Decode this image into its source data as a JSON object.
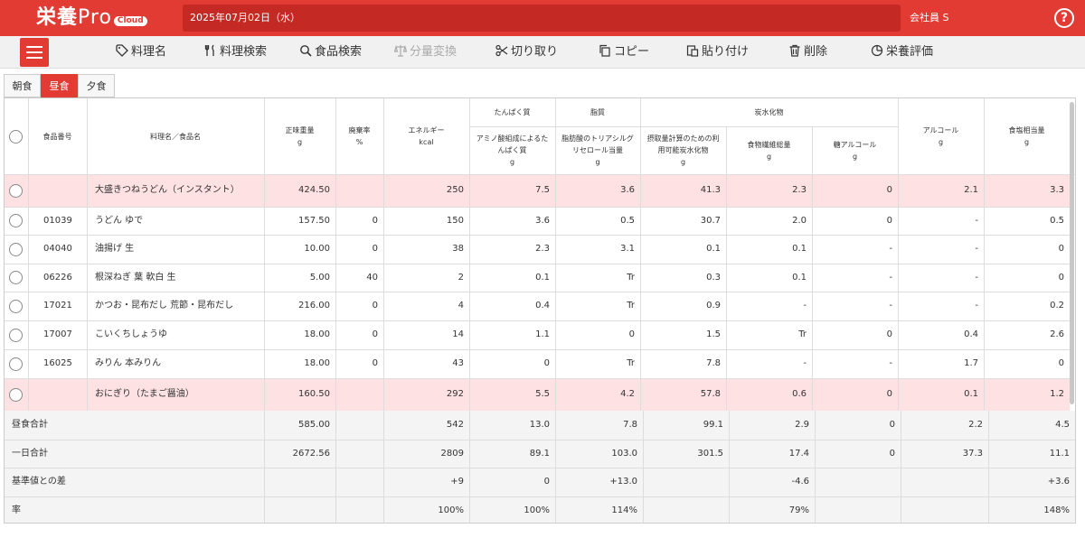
{
  "header": {
    "logo_main": "栄養",
    "logo_pro": "Pro",
    "logo_cloud": "Cloud",
    "date": "2025年07月02日（水）",
    "user": "会社員 S",
    "help_label": "?"
  },
  "toolbar": [
    {
      "label": "料理名",
      "icon": "tag-icon",
      "enabled": true
    },
    {
      "label": "料理検索",
      "icon": "utensils-icon",
      "enabled": true
    },
    {
      "label": "食品検索",
      "icon": "search-icon",
      "enabled": true
    },
    {
      "label": "分量変換",
      "icon": "scale-icon",
      "enabled": false
    },
    {
      "label": "切り取り",
      "icon": "scissors-icon",
      "enabled": true
    },
    {
      "label": "コピー",
      "icon": "copy-icon",
      "enabled": true
    },
    {
      "label": "貼り付け",
      "icon": "paste-icon",
      "enabled": true
    },
    {
      "label": "削除",
      "icon": "trash-icon",
      "enabled": true
    },
    {
      "label": "栄養評価",
      "icon": "pie-chart-icon",
      "enabled": true
    }
  ],
  "tabs": [
    {
      "label": "朝食",
      "active": false
    },
    {
      "label": "昼食",
      "active": true
    },
    {
      "label": "夕食",
      "active": false
    }
  ],
  "columns": {
    "code": "食品番号",
    "name": "料理名／食品名",
    "weight": [
      "正味重量",
      "g"
    ],
    "waste": [
      "廃棄率",
      "%"
    ],
    "energy": [
      "エネルギー",
      "kcal"
    ],
    "protein_group": "たんぱく質",
    "protein": [
      "アミノ酸組成によるた",
      "んぱく質",
      "g"
    ],
    "fat_group": "脂質",
    "fat": [
      "脂肪酸のトリアシルグ",
      "リセロール当量",
      "g"
    ],
    "carb_group": "炭水化物",
    "carb": [
      "摂取量計算のための利",
      "用可能炭水化物",
      "g"
    ],
    "fiber": [
      "食物繊維総量",
      "g"
    ],
    "sugar_alcohol": [
      "糖アルコール",
      "g"
    ],
    "alcohol": [
      "アルコール",
      "g"
    ],
    "salt": [
      "食塩相当量",
      "g"
    ]
  },
  "rows": [
    {
      "dish": true,
      "code": "",
      "name": "大盛きつねうどん（インスタント）",
      "weight": "424.50",
      "waste": "",
      "energy": "250",
      "protein": "7.5",
      "fat": "3.6",
      "carb": "41.3",
      "fiber": "2.3",
      "sugar_alcohol": "0",
      "alcohol": "2.1",
      "salt": "3.3"
    },
    {
      "dish": false,
      "code": "01039",
      "name": "うどん ゆで",
      "weight": "157.50",
      "waste": "0",
      "energy": "150",
      "protein": "3.6",
      "fat": "0.5",
      "carb": "30.7",
      "fiber": "2.0",
      "sugar_alcohol": "0",
      "alcohol": "-",
      "salt": "0.5"
    },
    {
      "dish": false,
      "code": "04040",
      "name": "油揚げ 生",
      "weight": "10.00",
      "waste": "0",
      "energy": "38",
      "protein": "2.3",
      "fat": "3.1",
      "carb": "0.1",
      "fiber": "0.1",
      "sugar_alcohol": "-",
      "alcohol": "-",
      "salt": "0"
    },
    {
      "dish": false,
      "code": "06226",
      "name": "根深ねぎ 葉 軟白 生",
      "weight": "5.00",
      "waste": "40",
      "energy": "2",
      "protein": "0.1",
      "fat": "Tr",
      "carb": "0.3",
      "fiber": "0.1",
      "sugar_alcohol": "-",
      "alcohol": "-",
      "salt": "0"
    },
    {
      "dish": false,
      "code": "17021",
      "name": "かつお・昆布だし 荒節・昆布だし",
      "weight": "216.00",
      "waste": "0",
      "energy": "4",
      "protein": "0.4",
      "fat": "Tr",
      "carb": "0.9",
      "fiber": "-",
      "sugar_alcohol": "-",
      "alcohol": "-",
      "salt": "0.2"
    },
    {
      "dish": false,
      "code": "17007",
      "name": "こいくちしょうゆ",
      "weight": "18.00",
      "waste": "0",
      "energy": "14",
      "protein": "1.1",
      "fat": "0",
      "carb": "1.5",
      "fiber": "Tr",
      "sugar_alcohol": "0",
      "alcohol": "0.4",
      "salt": "2.6"
    },
    {
      "dish": false,
      "code": "16025",
      "name": "みりん 本みりん",
      "weight": "18.00",
      "waste": "0",
      "energy": "43",
      "protein": "0",
      "fat": "Tr",
      "carb": "7.8",
      "fiber": "-",
      "sugar_alcohol": "-",
      "alcohol": "1.7",
      "salt": "0"
    },
    {
      "dish": true,
      "code": "",
      "name": "おにぎり（たまご醤油）",
      "weight": "160.50",
      "waste": "",
      "energy": "292",
      "protein": "5.5",
      "fat": "4.2",
      "carb": "57.8",
      "fiber": "0.6",
      "sugar_alcohol": "0",
      "alcohol": "0.1",
      "salt": "1.2"
    }
  ],
  "footer": [
    {
      "label": "昼食合計",
      "weight": "585.00",
      "waste": "",
      "energy": "542",
      "protein": "13.0",
      "fat": "7.8",
      "carb": "99.1",
      "fiber": "2.9",
      "sugar_alcohol": "0",
      "alcohol": "2.2",
      "salt": "4.5"
    },
    {
      "label": "一日合計",
      "weight": "2672.56",
      "waste": "",
      "energy": "2809",
      "protein": "89.1",
      "fat": "103.0",
      "carb": "301.5",
      "fiber": "17.4",
      "sugar_alcohol": "0",
      "alcohol": "37.3",
      "salt": "11.1"
    },
    {
      "label": "基準値との差",
      "weight": "",
      "waste": "",
      "energy": "+9",
      "protein": "0",
      "fat": "+13.0",
      "carb": "",
      "fiber": "-4.6",
      "sugar_alcohol": "",
      "alcohol": "",
      "salt": "+3.6"
    },
    {
      "label": "率",
      "weight": "",
      "waste": "",
      "energy": "100%",
      "protein": "100%",
      "fat": "114%",
      "carb": "",
      "fiber": "79%",
      "sugar_alcohol": "",
      "alcohol": "",
      "salt": "148%"
    }
  ],
  "colors": {
    "accent": "#e23b33",
    "dish_row": "#fde1e3"
  }
}
